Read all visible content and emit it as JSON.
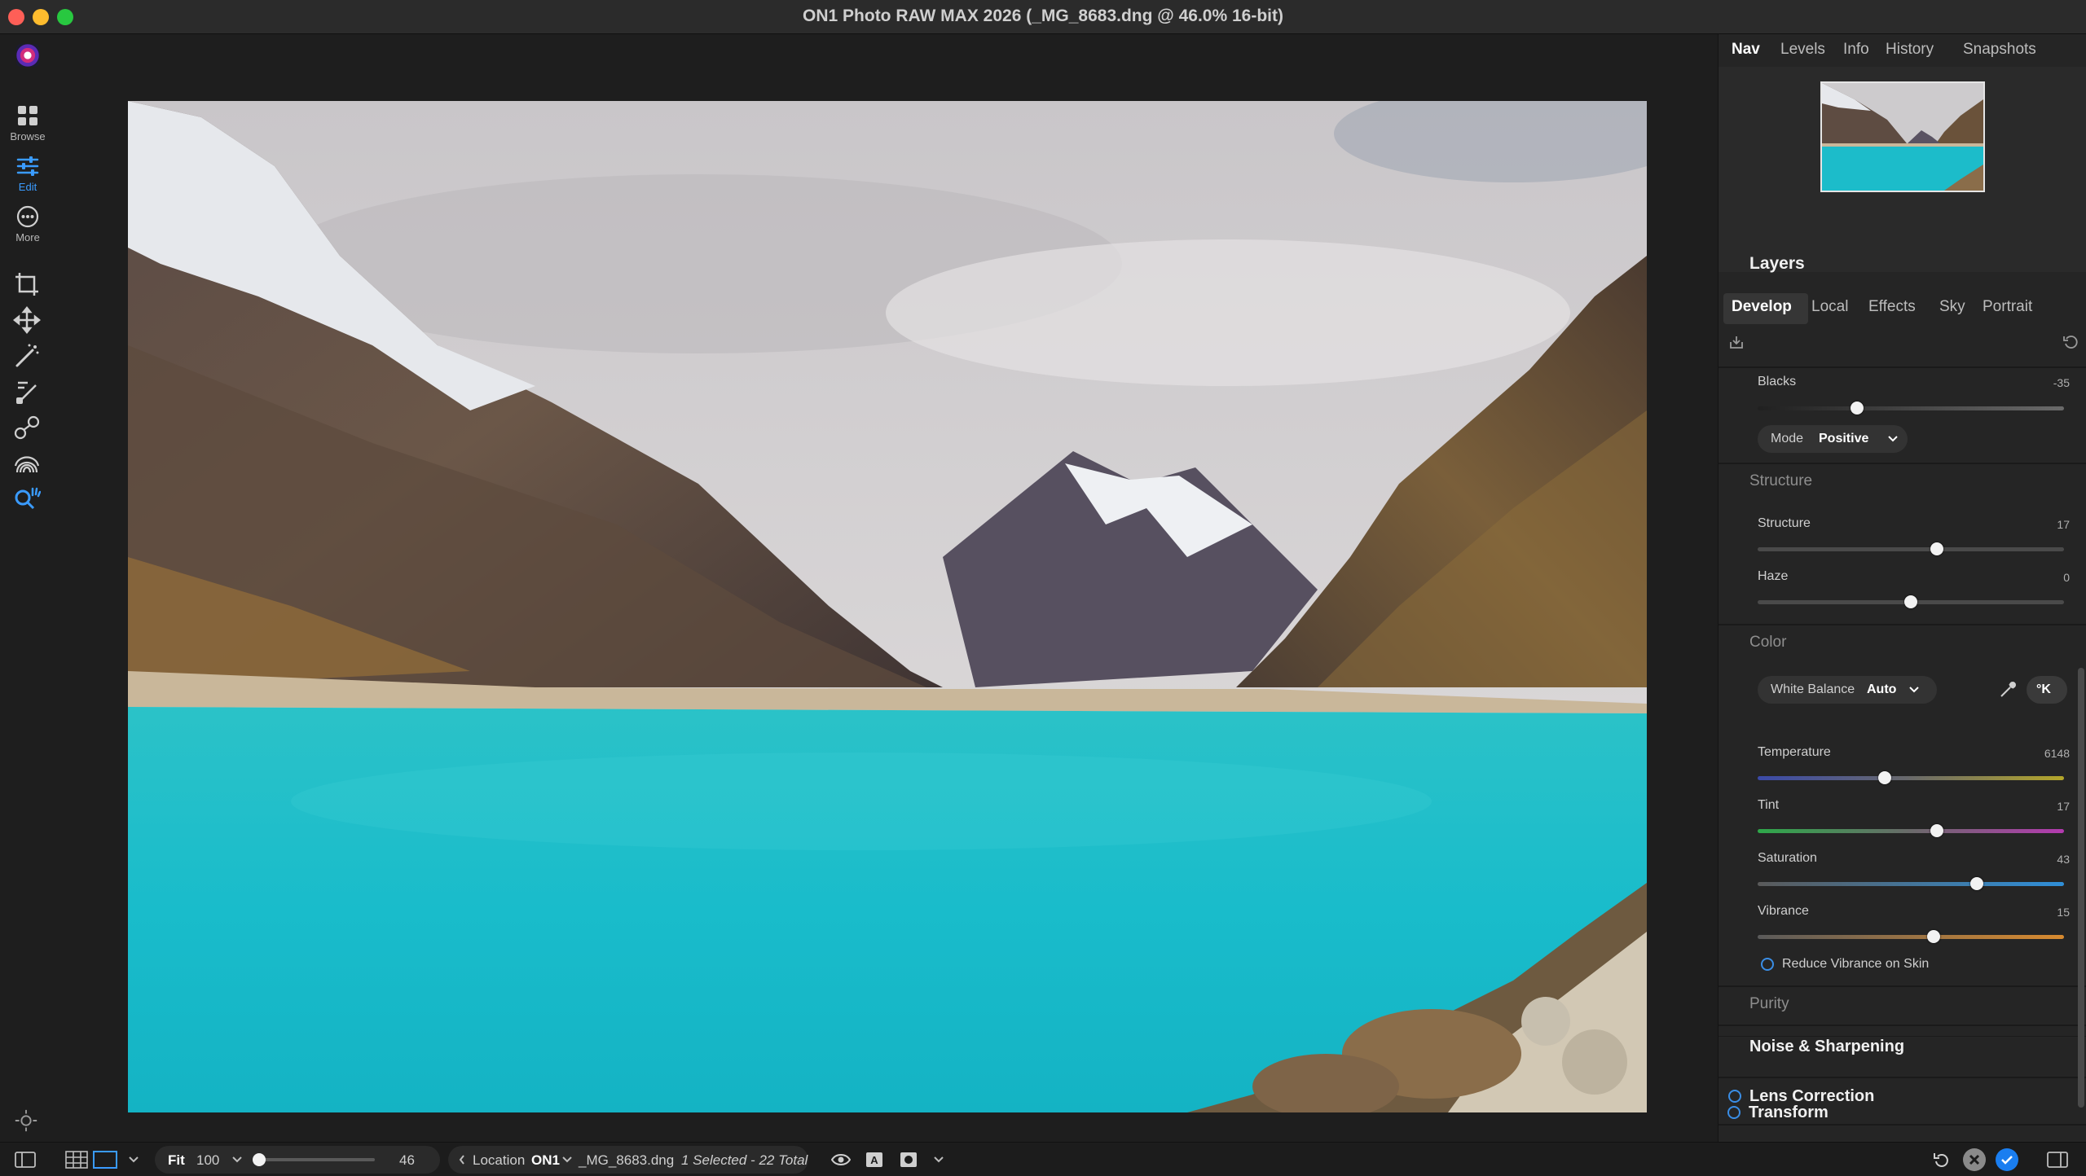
{
  "window": {
    "title": "ON1 Photo RAW MAX 2026 (_MG_8683.dng @ 46.0% 16-bit)"
  },
  "rail": {
    "items": [
      {
        "label": "Browse",
        "icon": "grid-icon"
      },
      {
        "label": "Edit",
        "icon": "sliders-icon"
      },
      {
        "label": "More",
        "icon": "more-dots-icon"
      }
    ]
  },
  "panel": {
    "tabs": [
      "Nav",
      "Levels",
      "Info",
      "History",
      "Snapshots"
    ],
    "layers_title": "Layers",
    "subtabs": [
      "Develop",
      "Local",
      "Effects",
      "Sky",
      "Portrait"
    ],
    "tone": {
      "blacks": {
        "label": "Blacks",
        "value": -35,
        "value_text": "-35"
      },
      "mode_label": "Mode",
      "mode_value": "Positive"
    },
    "structure": {
      "title": "Structure",
      "structure": {
        "label": "Structure",
        "value": 17,
        "value_text": "17"
      },
      "haze": {
        "label": "Haze",
        "value": 0,
        "value_text": "0"
      }
    },
    "color": {
      "title": "Color",
      "wb_label": "White Balance",
      "wb_value": "Auto",
      "kelvin_button": "°K",
      "temperature": {
        "label": "Temperature",
        "value": 6148,
        "value_text": "6148"
      },
      "tint": {
        "label": "Tint",
        "value": 17,
        "value_text": "17"
      },
      "saturation": {
        "label": "Saturation",
        "value": 43,
        "value_text": "43"
      },
      "vibrance": {
        "label": "Vibrance",
        "value": 15,
        "value_text": "15"
      },
      "reduce_vibrance": "Reduce Vibrance on Skin"
    },
    "purity_title": "Purity",
    "noise_title": "Noise & Sharpening",
    "lens_title": "Lens Correction",
    "transform_title": "Transform"
  },
  "bottom": {
    "fit": "Fit",
    "zoom_preset": "100",
    "zoom_value": "46",
    "location_label": "Location",
    "location_value": "ON1",
    "filename": "_MG_8683.dng",
    "selection": "1 Selected - 22 Total"
  },
  "colors": {
    "accent": "#3a9bff",
    "panel_bg": "#252525",
    "lake": "#1fbfcc",
    "confirm": "#1a7ef0"
  }
}
